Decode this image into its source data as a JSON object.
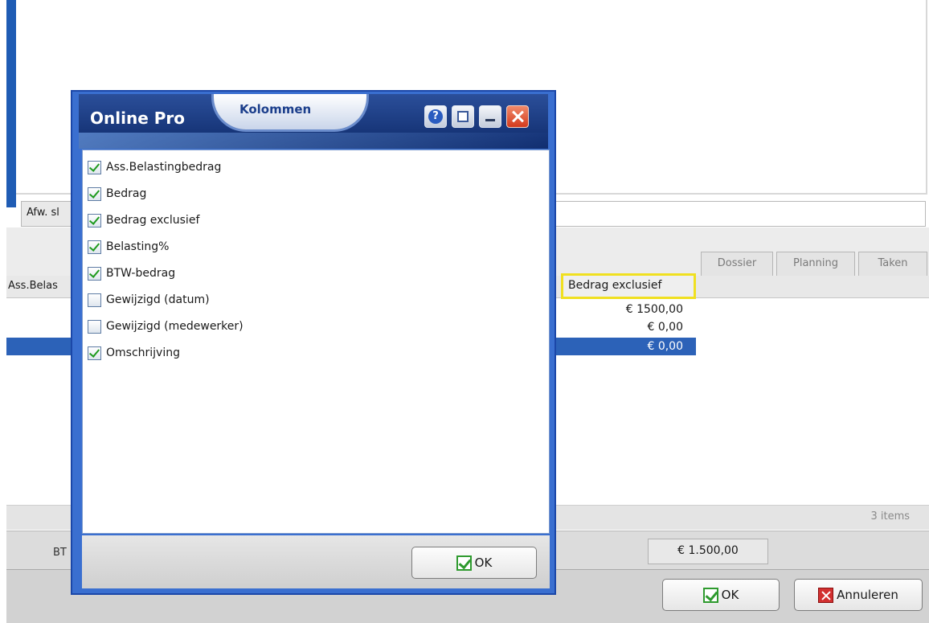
{
  "background": {
    "afw_label": "Afw. sl",
    "tabs": [
      {
        "label": "Dossier"
      },
      {
        "label": "Planning"
      },
      {
        "label": "Taken"
      }
    ],
    "grid": {
      "first_header": "Ass.Belas",
      "highlighted_header": "Bedrag exclusief",
      "rows": [
        {
          "value": "€ 1500,00",
          "selected": false
        },
        {
          "value": "€ 0,00",
          "selected": false
        },
        {
          "value": "€ 0,00",
          "selected": true
        }
      ],
      "items_count": "3 items"
    },
    "total_label": "BT",
    "total_value": "€ 1.500,00",
    "ok_label": "OK",
    "cancel_label": "Annuleren"
  },
  "dialog": {
    "app_name": "Online Pro",
    "title": "Kolommen",
    "columns": [
      {
        "label": "Ass.Belastingbedrag",
        "checked": true
      },
      {
        "label": "Bedrag",
        "checked": true
      },
      {
        "label": "Bedrag exclusief",
        "checked": true
      },
      {
        "label": "Belasting%",
        "checked": true
      },
      {
        "label": "BTW-bedrag",
        "checked": true
      },
      {
        "label": "Gewijzigd (datum)",
        "checked": false
      },
      {
        "label": "Gewijzigd (medewerker)",
        "checked": false
      },
      {
        "label": "Omschrijving",
        "checked": true
      }
    ],
    "ok_label": "OK"
  },
  "colors": {
    "accent_blue": "#3a6fd0",
    "selection_blue": "#2c62b8",
    "highlight_yellow": "#f0e020",
    "check_green": "#2e9a2e",
    "close_red": "#d43a1c"
  }
}
